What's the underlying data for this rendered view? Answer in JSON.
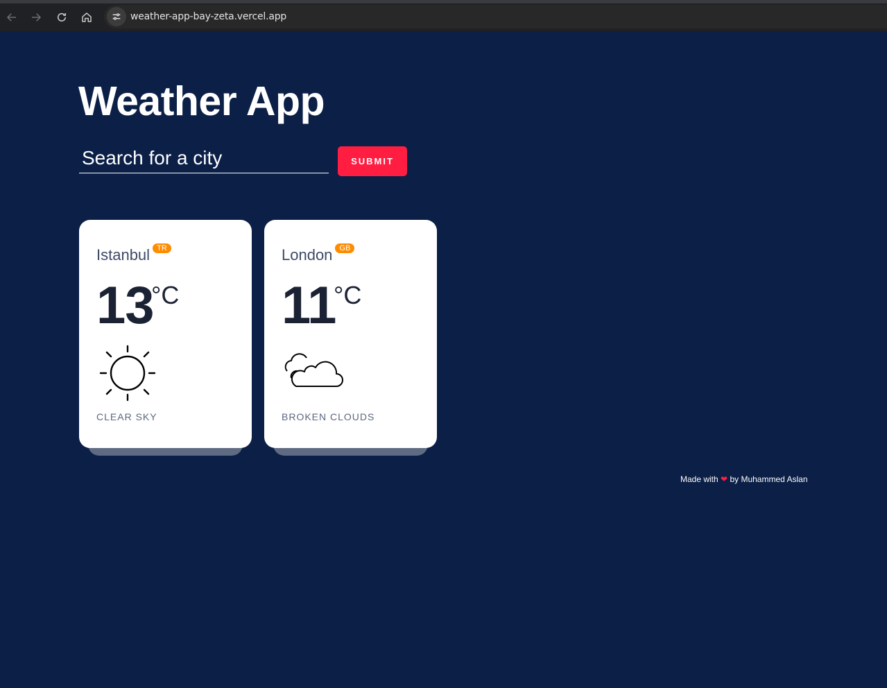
{
  "browser": {
    "url": "weather-app-bay-zeta.vercel.app"
  },
  "app": {
    "title": "Weather App"
  },
  "search": {
    "placeholder": "Search for a city",
    "submit_label": "SUBMIT"
  },
  "cities": [
    {
      "name": "Istanbul",
      "country": "TR",
      "temp": "13",
      "unit": "°C",
      "condition": "CLEAR SKY",
      "icon": "sun-icon"
    },
    {
      "name": "London",
      "country": "GB",
      "temp": "11",
      "unit": "°C",
      "condition": "BROKEN CLOUDS",
      "icon": "broken-clouds-icon"
    }
  ],
  "footer": {
    "made_with": "Made with",
    "by_text": "by Muhammed Aslan",
    "heart": "❤"
  },
  "colors": {
    "background": "#0b1f47",
    "accent": "#ff1e42",
    "badge": "#ff8c00"
  }
}
